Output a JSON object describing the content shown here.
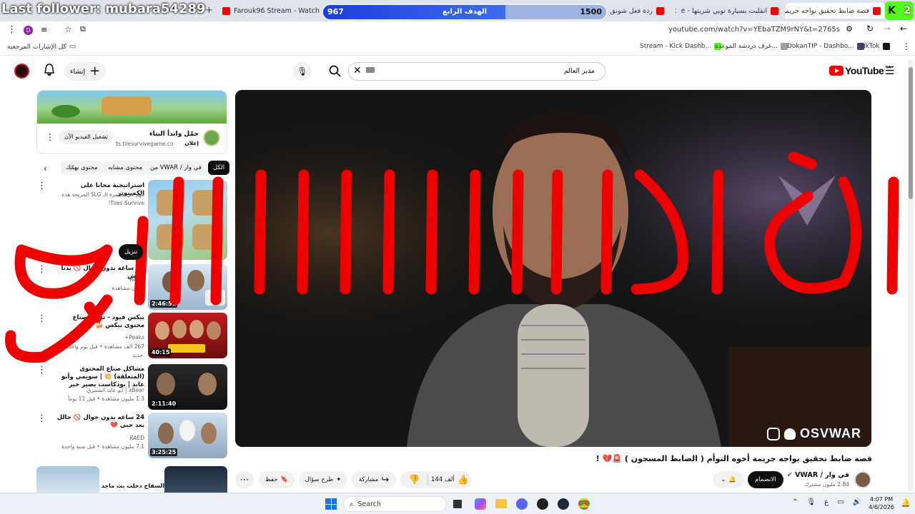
{
  "browser": {
    "tabs": [
      {
        "title": "Farouk96 Stream - Watch Live",
        "color": "#53fc18"
      },
      {
        "title": "ردة فعل شونق على",
        "color": "#ff0000"
      },
      {
        "title": "Watch Live",
        "color": "#53fc18"
      },
      {
        "title": "انقلبت بسيارة تويي شريتها - e",
        "color": "#ff0000"
      },
      {
        "title": "قصة ضابط تحقيق يواجه جريمة أ",
        "color": "#ff0000"
      }
    ],
    "url": "youtube.com/watch?v=YEbaTZM9rNY&t=2765s",
    "profile_letter": "D"
  },
  "bookmarks": {
    "all_label": "كل الإشارات المرجعية",
    "items": [
      {
        "label": "Stream - Kick Dashb...",
        "color": "#53fc18"
      },
      {
        "label": "غرف دردشة الموعدة...",
        "color": "#9aa0a6"
      },
      {
        "label": "DokanTIP - Dashbo...",
        "color": "#4a3d7a"
      },
      {
        "label": "TikTok",
        "color": "#111111"
      }
    ]
  },
  "stream_overlay": {
    "last_follower": "Last follower: mubara54289",
    "goal_current": "967",
    "goal_label": "الهدف الرابع",
    "goal_target": "1500",
    "goal_progress": 0.645,
    "counter_left": "2",
    "big_red_text": "انا نااااااايم"
  },
  "youtube": {
    "logo_text": "YouTube",
    "region": "SA",
    "search_value": "مدير العالم",
    "create_label": "إنشاء",
    "ad": {
      "title": "حمّل وابدأ البناء",
      "sponsor": "إعلان",
      "domain": "ts.tilesurvivegame.co...",
      "cta": "تشغيل الفيديو الآن"
    },
    "chips": [
      "الكل",
      "من VWAR / في وار",
      "محتوى مشابه",
      "محتوى يهمّك"
    ],
    "download_label": "تنزيل",
    "recommendations": [
      {
        "title": "استراتيجية مجاناً على الكمبيوتر",
        "line2": "مهم في معامرة الـ SLG المريحة هذه",
        "meta": "Tiles Survive!",
        "duration": ""
      },
      {
        "title": "24 ساعه بدون جوال 🚫 بدنا نعيش",
        "channel": "RAED",
        "meta": "مليون مشاهدة",
        "duration": "2:46:51"
      },
      {
        "title": "بيكس فيود - تحدي صناع محتوى بيكس 🍰",
        "channel": "Peaks+",
        "meta": "267 ألف مشاهدة • قبل يوم واحد",
        "badge": "جديد",
        "duration": "40:15"
      },
      {
        "title": "مشاكل صناع المحتوى (المتعلقة) 💥 | سويمي وأبو عابد | بودكاست يصير خير",
        "channel": "xBear | أبو عابد الشمري",
        "meta": "1.3 مليون مشاهدة • قبل 11 يوماً",
        "duration": "2:11:40"
      },
      {
        "title": "24 ساعه بدون جوال 🚫 حالل بعد حبي 💔",
        "channel": "RAED",
        "meta": "7.1 مليون مشاهدة • قبل سنة واحدة",
        "duration": "3:25:25"
      },
      {
        "title": "السفاح دخلت بث ماجد",
        "channel": "",
        "meta": "",
        "duration": ""
      }
    ],
    "watermark": "OSVWAR",
    "video_title": "قصة ضابط تحقيق يواجه جريمة أخوه التوأم ( الضابط المسجون ) 🚨💔 !",
    "channel_name": "في وار / VWAR",
    "subscribers": "2.84 مليون مشترك",
    "join_label": "الانضمام",
    "likes": "144 ألف",
    "share_label": "مشاركة",
    "ask_label": "طرح سؤال",
    "save_label": "حفظ"
  },
  "taskbar": {
    "search_placeholder": "Search",
    "time": "4:07 PM",
    "date": "4/6/2026",
    "lang": "ع"
  },
  "colors": {
    "yt_red": "#ff0000",
    "kick_green": "#53fc18",
    "overlay_red": "#ee0000"
  }
}
